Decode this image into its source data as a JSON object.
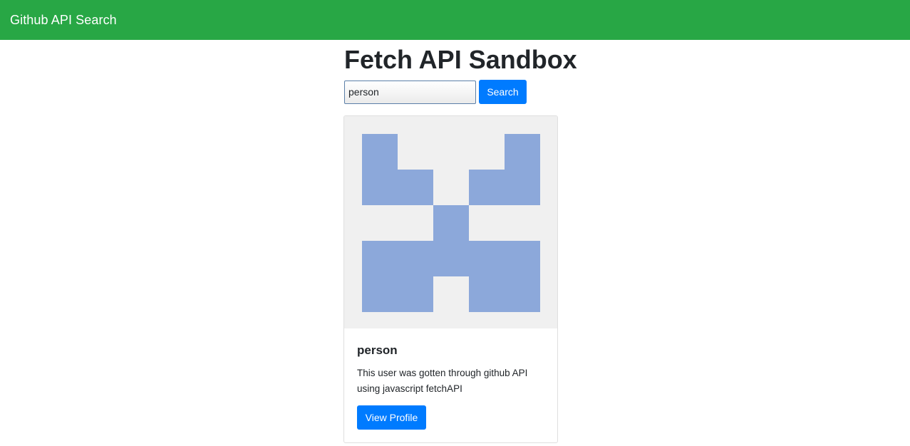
{
  "navbar": {
    "brand": "Github API Search"
  },
  "page": {
    "title": "Fetch API Sandbox"
  },
  "search": {
    "value": "person",
    "button_label": "Search"
  },
  "user_card": {
    "name": "person",
    "description": "This user was gotten through github API using javascript fetchAPI",
    "button_label": "View Profile",
    "avatar_color": "#8ca8da",
    "avatar_bg": "#f0f0f0"
  },
  "colors": {
    "navbar": "#28a745",
    "primary_button": "#007bff"
  }
}
